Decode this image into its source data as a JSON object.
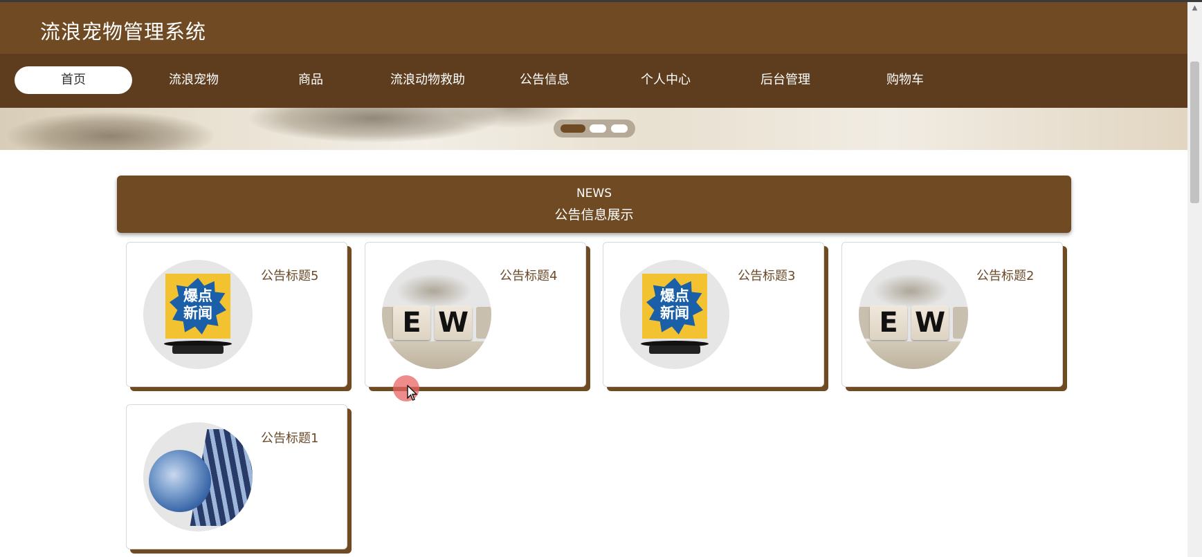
{
  "app": {
    "title": "流浪宠物管理系统"
  },
  "nav": {
    "items": [
      {
        "label": "首页",
        "active": true
      },
      {
        "label": "流浪宠物",
        "active": false
      },
      {
        "label": "商品",
        "active": false
      },
      {
        "label": "流浪动物救助",
        "active": false
      },
      {
        "label": "公告信息",
        "active": false
      },
      {
        "label": "个人中心",
        "active": false
      },
      {
        "label": "后台管理",
        "active": false
      },
      {
        "label": "购物车",
        "active": false
      }
    ]
  },
  "banner": {
    "slides": 3,
    "active_slide": 1
  },
  "news": {
    "heading_en": "NEWS",
    "heading_zh": "公告信息展示",
    "cards": [
      {
        "title": "公告标题5",
        "image": "breaking-news-sign-icon"
      },
      {
        "title": "公告标题4",
        "image": "letter-blocks-image"
      },
      {
        "title": "公告标题3",
        "image": "breaking-news-sign-icon"
      },
      {
        "title": "公告标题2",
        "image": "letter-blocks-image"
      },
      {
        "title": "公告标题1",
        "image": "globe-news-image"
      }
    ],
    "blocks_letters": [
      "E",
      "W"
    ],
    "burst_text": "爆点新闻"
  },
  "colors": {
    "primary": "#6f4a23",
    "nav": "#5e3d1f",
    "card_title": "#6b4a2a"
  }
}
